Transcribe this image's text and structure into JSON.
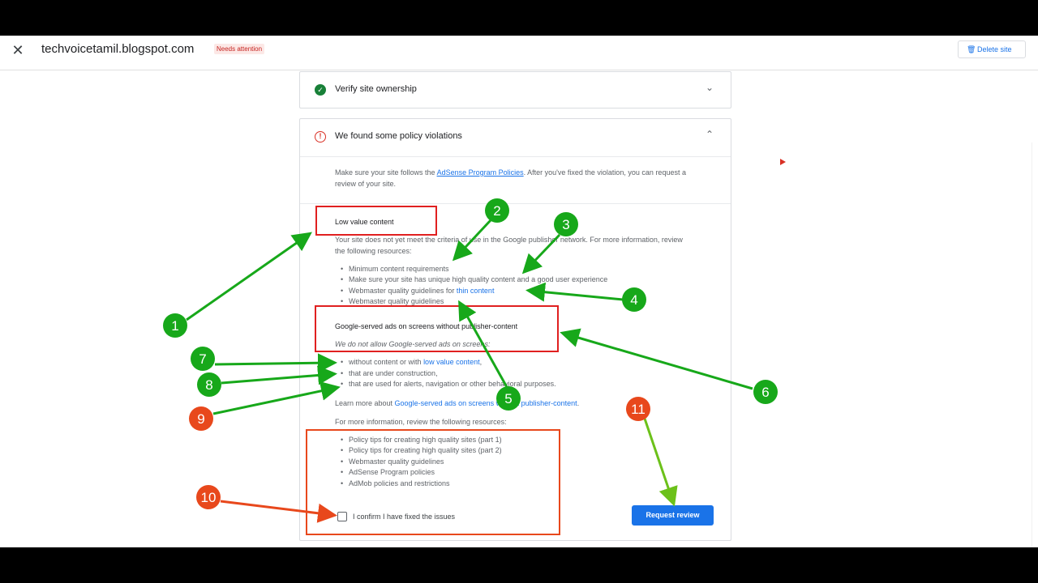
{
  "header": {
    "site": "techvoicetamil.blogspot.com",
    "badge": "Needs attention",
    "delete_label": "Delete site",
    "close_icon": "close-icon",
    "delete_icon": "trash-icon"
  },
  "card_verify": {
    "title": "Verify site ownership",
    "status": "check-circle-icon"
  },
  "card_policy": {
    "title": "We found some policy violations",
    "intro_pre": "Make sure your site follows the ",
    "intro_link": "AdSense Program Policies",
    "intro_post": ". After you've fixed the violation, you can request a",
    "intro_line2": "review of your site.",
    "section1_title": "Low value content",
    "section1_desc_line1": "Your site does not yet meet the criteria of use in the Google publisher network. For more information, review",
    "section1_desc_line2": "the following resources:",
    "section1_bullet1": "Minimum content requirements",
    "section1_bullet2": "Make sure your site has unique high quality content and a good user experience",
    "section1_bullet3_pre": "Webmaster quality guidelines for ",
    "section1_bullet3_link": "thin content",
    "section1_bullet4": "Webmaster quality guidelines",
    "section2_title": "Google-served ads on screens without publisher-content",
    "section2_sub": "We do not allow Google-served ads on screens:",
    "section2_bullet1_pre": "without content or with ",
    "section2_bullet1_link": "low value content",
    "section2_bullet1_post": ",",
    "section2_bullet2": "that are under construction,",
    "section2_bullet3": "that are used for alerts, navigation or other behavioral purposes.",
    "learn_more_pre": "Learn more about ",
    "learn_more_link": "Google-served ads on screens without publisher-content",
    "learn_more_post": ".",
    "resources_intro": "For more information, review the following resources:",
    "resources": [
      "Policy tips for creating high quality sites (part 1)",
      "Policy tips for creating high quality sites (part 2)",
      "Webmaster quality guidelines",
      "AdSense Program policies",
      "AdMob policies and restrictions"
    ],
    "confirm_label": "I confirm I have fixed the issues",
    "request_review": "Request review"
  },
  "annotations": [
    "1",
    "2",
    "3",
    "4",
    "5",
    "6",
    "7",
    "8",
    "9",
    "10",
    "11"
  ],
  "colors": {
    "green": "#17a81a",
    "orange_red": "#e8481c",
    "box_red": "#e02020",
    "blue": "#1a73e8"
  }
}
